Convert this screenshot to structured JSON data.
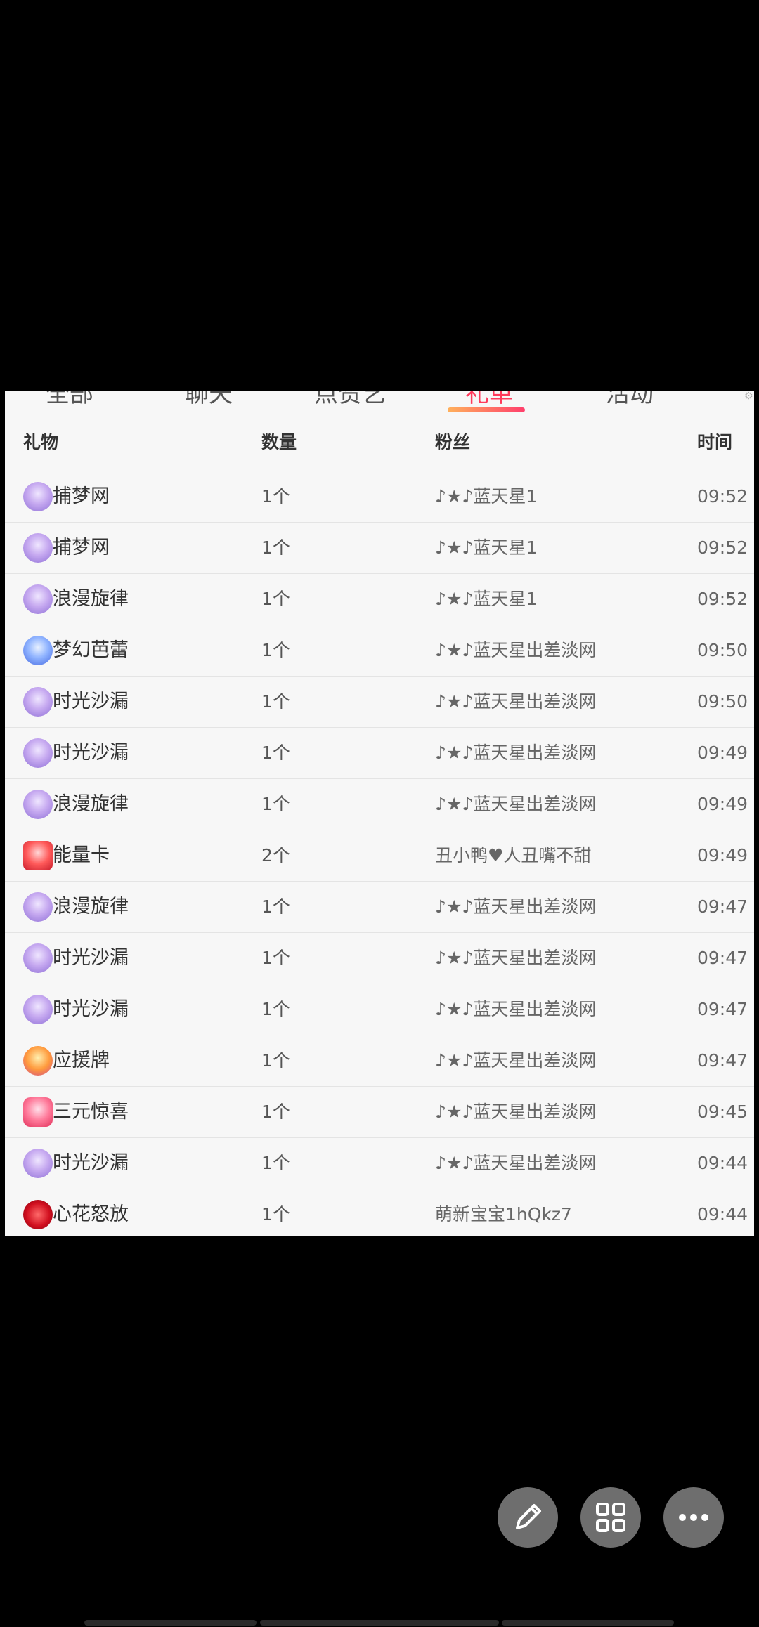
{
  "tabs": [
    {
      "label": "全部",
      "active": false
    },
    {
      "label": "聊天",
      "active": false
    },
    {
      "label": "点赞艺",
      "active": false
    },
    {
      "label": "礼单",
      "active": true
    },
    {
      "label": "活动",
      "active": false
    }
  ],
  "table": {
    "headers": {
      "gift": "礼物",
      "qty": "数量",
      "fan": "粉丝",
      "time": "时间"
    },
    "rows": [
      {
        "gift": "捕梦网",
        "icon": "dreamcatcher-icon",
        "qty": "1个",
        "fan": "♪★♪蓝天星1",
        "time": "09:52"
      },
      {
        "gift": "捕梦网",
        "icon": "dreamcatcher-icon",
        "qty": "1个",
        "fan": "♪★♪蓝天星1",
        "time": "09:52"
      },
      {
        "gift": "浪漫旋律",
        "icon": "melody-icon",
        "qty": "1个",
        "fan": "♪★♪蓝天星1",
        "time": "09:52"
      },
      {
        "gift": "梦幻芭蕾",
        "icon": "ballet-icon",
        "qty": "1个",
        "fan": "♪★♪蓝天星出差淡网",
        "time": "09:50"
      },
      {
        "gift": "时光沙漏",
        "icon": "hourglass-icon",
        "qty": "1个",
        "fan": "♪★♪蓝天星出差淡网",
        "time": "09:50"
      },
      {
        "gift": "时光沙漏",
        "icon": "hourglass-icon",
        "qty": "1个",
        "fan": "♪★♪蓝天星出差淡网",
        "time": "09:49"
      },
      {
        "gift": "浪漫旋律",
        "icon": "melody-icon",
        "qty": "1个",
        "fan": "♪★♪蓝天星出差淡网",
        "time": "09:49"
      },
      {
        "gift": "能量卡",
        "icon": "energy-card-icon",
        "qty": "2个",
        "fan": "丑小鸭♥人丑嘴不甜",
        "time": "09:49"
      },
      {
        "gift": "浪漫旋律",
        "icon": "melody-icon",
        "qty": "1个",
        "fan": "♪★♪蓝天星出差淡网",
        "time": "09:47"
      },
      {
        "gift": "时光沙漏",
        "icon": "hourglass-icon",
        "qty": "1个",
        "fan": "♪★♪蓝天星出差淡网",
        "time": "09:47"
      },
      {
        "gift": "时光沙漏",
        "icon": "hourglass-icon",
        "qty": "1个",
        "fan": "♪★♪蓝天星出差淡网",
        "time": "09:47"
      },
      {
        "gift": "应援牌",
        "icon": "cheer-sign-icon",
        "qty": "1个",
        "fan": "♪★♪蓝天星出差淡网",
        "time": "09:47"
      },
      {
        "gift": "三元惊喜",
        "icon": "surprise-box-icon",
        "qty": "1个",
        "fan": "♪★♪蓝天星出差淡网",
        "time": "09:45"
      },
      {
        "gift": "时光沙漏",
        "icon": "hourglass-icon",
        "qty": "1个",
        "fan": "♪★♪蓝天星出差淡网",
        "time": "09:44"
      },
      {
        "gift": "心花怒放",
        "icon": "flower-bouquet-icon",
        "qty": "1个",
        "fan": "萌新宝宝1hQkz7",
        "time": "09:44"
      }
    ]
  },
  "fabs": [
    {
      "icon": "pencil-icon"
    },
    {
      "icon": "grid-icon"
    },
    {
      "icon": "more-dots-icon"
    }
  ],
  "colors": {
    "accent": "#ff3b5c",
    "fab": "#6e6e6e"
  }
}
